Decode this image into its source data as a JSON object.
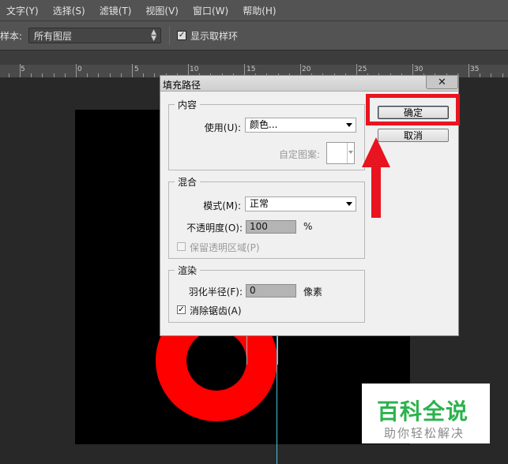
{
  "menu": {
    "items": [
      "文字(Y)",
      "选择(S)",
      "滤镜(T)",
      "视图(V)",
      "窗口(W)",
      "帮助(H)"
    ]
  },
  "options": {
    "sample_label": "样本:",
    "sample_value": "所有图层",
    "show_ring_label": "显示取样环",
    "show_ring_checked": "✓"
  },
  "ruler": {
    "labels": [
      "5",
      "0",
      "5",
      "10",
      "15",
      "20",
      "25",
      "30",
      "35"
    ]
  },
  "dialog": {
    "title": "填充路径",
    "close_glyph": "✕",
    "content": {
      "legend": "内容",
      "use_label": "使用(U):",
      "use_value": "颜色...",
      "pattern_label": "自定图案:"
    },
    "blend": {
      "legend": "混合",
      "mode_label": "模式(M):",
      "mode_value": "正常",
      "opacity_label": "不透明度(O):",
      "opacity_value": "100",
      "opacity_unit": "%",
      "preserve_label": "保留透明区域(P)"
    },
    "render": {
      "legend": "渲染",
      "feather_label": "羽化半径(F):",
      "feather_value": "0",
      "feather_unit": "像素",
      "antialias_label": "消除锯齿(A)",
      "antialias_check": "✓"
    },
    "ok_label": "确定",
    "cancel_label": "取消"
  },
  "watermark": {
    "title": "百科全说",
    "subtitle": "助你轻松解决"
  },
  "colors": {
    "annotation": "#e8141f",
    "fill": "#ff0000",
    "watermark_green": "#2bb24c"
  }
}
